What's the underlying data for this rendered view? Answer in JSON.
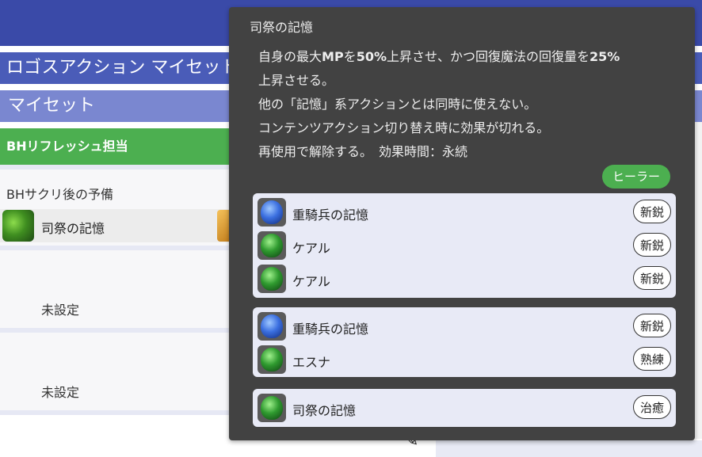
{
  "header": {
    "page_title": "ロゴスアクション マイセット",
    "myset_title": "マイセット"
  },
  "left": {
    "section_label": "BHリフレッシュ担当",
    "card1": {
      "title": "BHサクリ後の予備",
      "slot_label": "司祭の記憶"
    },
    "unset_label_1": "未設定",
    "unset_label_2": "未設定"
  },
  "tooltip": {
    "title": "司祭の記憶",
    "line1_pre": "自身の最大",
    "line1_mp": "MP",
    "line1_mid": "を",
    "line1_pct1": "50%",
    "line1_post": "上昇させ、かつ回復魔法の回復量を",
    "line1_pct2": "25%",
    "line2": "上昇させる。",
    "line3": "他の「記憶」系アクションとは同時に使えない。",
    "line4": "コンテンツアクション切り替え時に効果が切れる。",
    "line5": "再使用で解除する。　効果時間：永続",
    "role_badge": "ヒーラー",
    "group1": [
      {
        "label": "重騎兵の記憶",
        "tag": "新鋭",
        "icon": "blue-gem-icon"
      },
      {
        "label": "ケアル",
        "tag": "新鋭",
        "icon": "green-gem-icon"
      },
      {
        "label": "ケアル",
        "tag": "新鋭",
        "icon": "green-gem-icon"
      }
    ],
    "group2": [
      {
        "label": "重騎兵の記憶",
        "tag": "新鋭",
        "icon": "blue-gem-icon"
      },
      {
        "label": "エスナ",
        "tag": "熟練",
        "icon": "green-gem-icon"
      }
    ],
    "group3": [
      {
        "label": "司祭の記憶",
        "tag": "治癒",
        "icon": "green-gem-icon"
      }
    ]
  },
  "colors": {
    "topbar": "#3a4aa8",
    "title_band": "#4a5cb8",
    "myset_band": "#7a87d0",
    "section_green": "#4caf50",
    "tooltip_bg": "#424242",
    "group_bg": "#e8eaf6"
  }
}
